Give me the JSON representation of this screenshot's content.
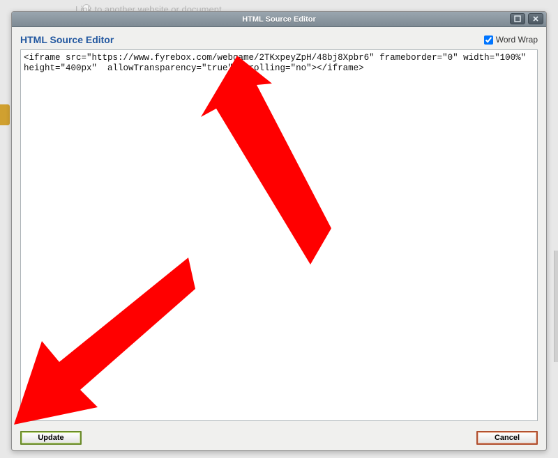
{
  "background": {
    "hint_text": "Link to another website or document"
  },
  "dialog": {
    "title": "HTML Source Editor",
    "header": "HTML Source Editor",
    "wordwrap_label": "Word Wrap",
    "wordwrap_checked": true,
    "source_code": "<iframe src=\"https://www.fyrebox.com/webgame/2TKxpeyZpH/48bj8Xpbr6\" frameborder=\"0\" width=\"100%\" height=\"400px\"  allowTransparency=\"true\" scrolling=\"no\"></iframe>",
    "buttons": {
      "update": "Update",
      "cancel": "Cancel"
    }
  }
}
